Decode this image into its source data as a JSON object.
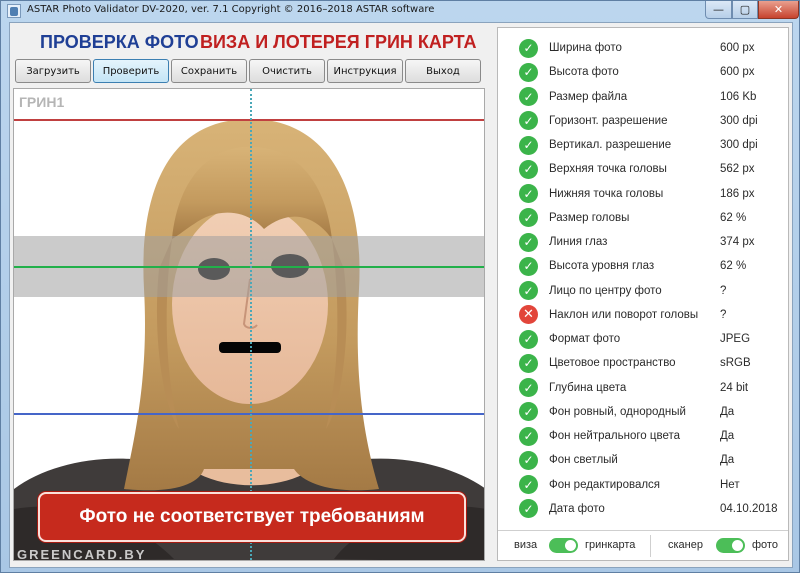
{
  "window": {
    "title": "ASTAR Photo Validator DV-2020, ver. 7.1  Copyright © 2016–2018 ASTAR software",
    "minimize_glyph": "—",
    "maximize_glyph": "▢",
    "close_glyph": "✕"
  },
  "header": {
    "heading_left": "ПРОВЕРКА ФОТО",
    "heading_right": "ВИЗА И ЛОТЕРЕЯ ГРИН КАРТА"
  },
  "toolbar": {
    "buttons": [
      "Загрузить",
      "Проверить",
      "Сохранить",
      "Очистить",
      "Инструкция",
      "Выход"
    ],
    "active_button": "Проверить"
  },
  "photo": {
    "tag": "ГРИН1",
    "verdict": "Фото не соответствует требованиям",
    "watermark": "GREENCARD.BY"
  },
  "checks": [
    {
      "label": "Ширина фото",
      "value": "600 px",
      "status": "ok"
    },
    {
      "label": "Высота фото",
      "value": "600 px",
      "status": "ok"
    },
    {
      "label": "Размер файла",
      "value": "106 Kb",
      "status": "ok"
    },
    {
      "label": "Горизонт. разрешение",
      "value": "300 dpi",
      "status": "ok"
    },
    {
      "label": "Вертикал. разрешение",
      "value": "300 dpi",
      "status": "ok"
    },
    {
      "label": "Верхняя точка головы",
      "value": "562 px",
      "status": "ok"
    },
    {
      "label": "Нижняя точка головы",
      "value": "186 px",
      "status": "ok"
    },
    {
      "label": "Размер головы",
      "value": "62 %",
      "status": "ok"
    },
    {
      "label": "Линия глаз",
      "value": "374 px",
      "status": "ok"
    },
    {
      "label": "Высота уровня глаз",
      "value": "62 %",
      "status": "ok"
    },
    {
      "label": "Лицо по центру фото",
      "value": "?",
      "status": "ok"
    },
    {
      "label": "Наклон или поворот головы",
      "value": "?",
      "status": "fail"
    },
    {
      "label": "Формат фото",
      "value": "JPEG",
      "status": "ok"
    },
    {
      "label": "Цветовое пространство",
      "value": "sRGB",
      "status": "ok"
    },
    {
      "label": "Глубина цвета",
      "value": "24 bit",
      "status": "ok"
    },
    {
      "label": "Фон ровный, однородный",
      "value": "Да",
      "status": "ok"
    },
    {
      "label": "Фон нейтрального цвета",
      "value": "Да",
      "status": "ok"
    },
    {
      "label": "Фон светлый",
      "value": "Да",
      "status": "ok"
    },
    {
      "label": "Фон редактировался",
      "value": "Нет",
      "status": "ok"
    },
    {
      "label": "Дата фото",
      "value": "04.10.2018",
      "status": "ok"
    }
  ],
  "footer": {
    "left_off_label": "виза",
    "left_on_label": "гринкарта",
    "left_toggle_on": true,
    "right_off_label": "сканер",
    "right_on_label": "фото",
    "right_toggle_on": true
  },
  "colors": {
    "ok": "#3bb44a",
    "fail": "#e2453a",
    "heading_blue": "#1f3f95",
    "heading_red": "#c02020",
    "verdict_bg": "#c62a1d"
  },
  "icons": {
    "ok": "checkmark-icon",
    "fail": "cross-icon"
  }
}
